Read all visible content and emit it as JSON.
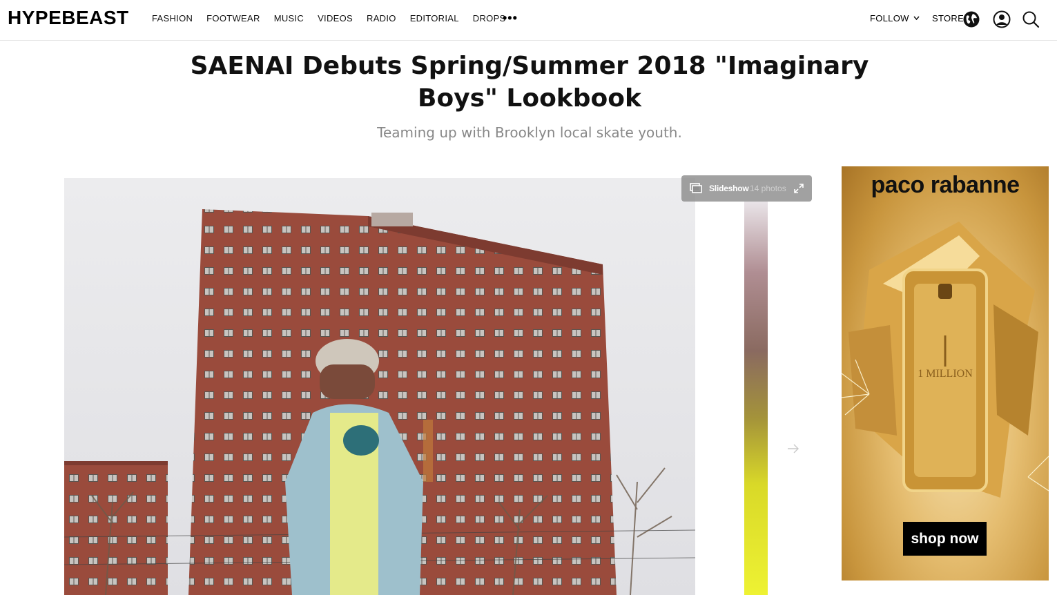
{
  "header": {
    "logo": "HYPEBEAST",
    "nav": [
      "FASHION",
      "FOOTWEAR",
      "MUSIC",
      "VIDEOS",
      "RADIO",
      "EDITORIAL",
      "DROPS"
    ],
    "more": "•••",
    "follow": "FOLLOW",
    "store": "STORE",
    "icons": [
      "globe-icon",
      "user-icon",
      "search-icon"
    ]
  },
  "article": {
    "title": "SAENAI Debuts Spring/Summer 2018 \"Imaginary Boys\" Lookbook",
    "subtitle": "Teaming up with Brooklyn local skate youth."
  },
  "gallery": {
    "slideshow_label": "Slideshow",
    "photo_count": "14 photos",
    "next_icon": "arrow-right-icon",
    "expand_icon": "expand-icon"
  },
  "ad": {
    "brand": "paco rabanne",
    "cta": "shop now",
    "bottle_text": "1 MILLION"
  }
}
